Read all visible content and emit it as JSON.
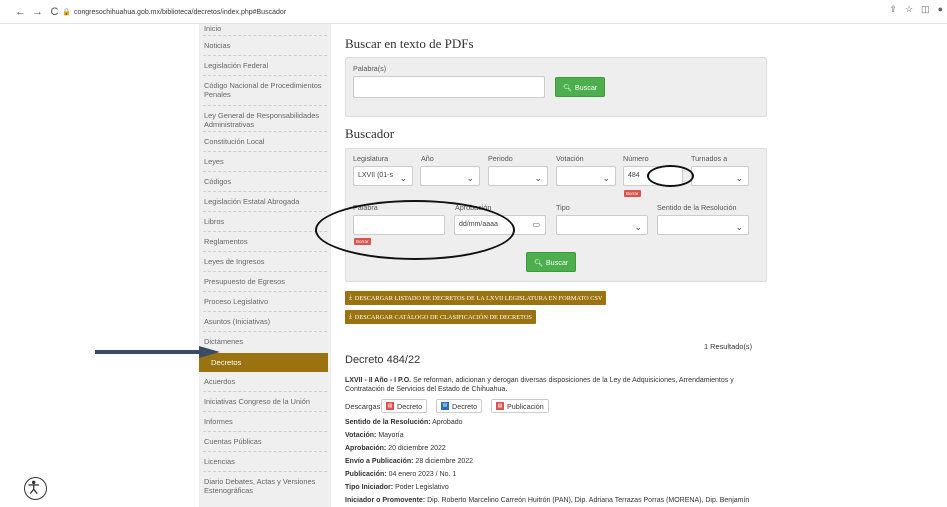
{
  "browser": {
    "url": "congresochihuahua.gob.mx/biblioteca/decretos/index.php#Buscador"
  },
  "sidebar": {
    "items": [
      {
        "label": "Inicio"
      },
      {
        "label": "Noticias"
      },
      {
        "label": "Legislación Federal"
      },
      {
        "label": "Código Nacional de Procedimientos Penales"
      },
      {
        "label": "Ley General de Responsabilidades Administrativas"
      },
      {
        "label": "Constitución Local"
      },
      {
        "label": "Leyes"
      },
      {
        "label": "Códigos"
      },
      {
        "label": "Legislación Estatal Abrogada"
      },
      {
        "label": "Libros"
      },
      {
        "label": "Reglamentos"
      },
      {
        "label": "Leyes de Ingresos"
      },
      {
        "label": "Presupuesto de Egresos"
      },
      {
        "label": "Proceso Legislativo"
      },
      {
        "label": "Asuntos (Iniciativas)"
      },
      {
        "label": "Dictámenes"
      },
      {
        "label": "Decretos"
      },
      {
        "label": "Acuerdos"
      },
      {
        "label": "Iniciativas Congreso de la Unión"
      },
      {
        "label": "Informes"
      },
      {
        "label": "Cuentas Públicas"
      },
      {
        "label": "Licencias"
      },
      {
        "label": "Diario Debates, Actas y Versiones Estenográficas"
      }
    ]
  },
  "pdf_search": {
    "title": "Buscar en texto de PDFs",
    "word_label": "Palabra(s)",
    "button_label": "Buscar"
  },
  "search": {
    "title": "Buscador",
    "labels": {
      "legislatura": "Legislatura",
      "anio": "Año",
      "periodo": "Periodo",
      "votacion": "Votación",
      "numero": "Número",
      "turnados": "Turnados a",
      "palabra": "Palabra",
      "aprobacion": "Aprobación",
      "tipo": "Tipo",
      "sentido": "Sentido de la Resolución"
    },
    "legislatura_value": "LXVII (01-s",
    "numero_value": "484",
    "fecha_placeholder": "dd/mm/aaaa",
    "borrar_label": "Borrar",
    "button_label": "Buscar"
  },
  "downloads": {
    "csv_label": "DESCARGAR LISTADO DE DECRETOS DE LA LXVII LEGISLATURA EN FORMATO CSV",
    "catalog_label": "DESCARGAR CATÁLOGO DE CLASIFICACIÓN DE DECRETOS"
  },
  "results": {
    "count": "1 Resultado(s)",
    "title": "Decreto 484/22",
    "summary_bold": "LXVII - II Año - I P.O.",
    "summary": "Se reforman, adicionan y derogan diversas disposiciones de la Ley de Adquisiciones, Arrendamientos y Contratación de Servicios del Estado de Chihuahua.",
    "downloads_label": "Descargas:",
    "dl_buttons": [
      "Decreto",
      "Decreto",
      "Publicación"
    ],
    "fields": [
      {
        "k": "Sentido de la Resolución:",
        "v": "Aprobado"
      },
      {
        "k": "Votación:",
        "v": "Mayoría"
      },
      {
        "k": "Aprobación:",
        "v": "20 diciembre 2022"
      },
      {
        "k": "Envío a Publicación:",
        "v": "28 diciembre 2022"
      },
      {
        "k": "Publicación:",
        "v": "04 enero 2023 / No. 1"
      },
      {
        "k": "Tipo Iniciador:",
        "v": "Poder Legislativo"
      },
      {
        "k": "Iniciador o Promovente:",
        "v": "Dip. Roberto Marcelino Carreón Huitrón (PAN), Dip. Adriana Terrazas Porras (MORENA), Dip. Benjamín"
      }
    ]
  },
  "colors": {
    "accent_gold": "#9a7310",
    "button_green": "#4cae4c",
    "borrar_red": "#d9534f",
    "sidebar_bg": "#efefef",
    "panel_bg": "#eeeeee"
  }
}
